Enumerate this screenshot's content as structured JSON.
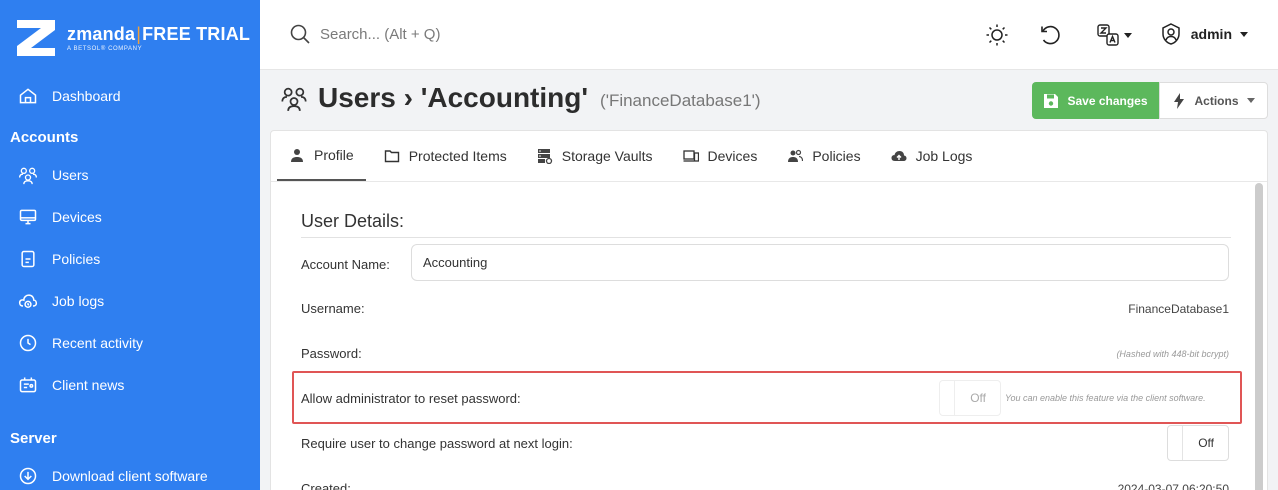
{
  "brand": {
    "name": "zmanda",
    "trial": "FREE TRIAL",
    "separator": "|",
    "tagline": "A BETSOL® COMPANY"
  },
  "sidebar": {
    "dashboard": "Dashboard",
    "accounts_heading": "Accounts",
    "accounts_items": [
      "Users",
      "Devices",
      "Policies",
      "Job logs",
      "Recent activity",
      "Client news"
    ],
    "server_heading": "Server",
    "server_items": [
      "Download client software"
    ]
  },
  "topbar": {
    "search_placeholder": "Search... (Alt + Q)",
    "user": "admin"
  },
  "page": {
    "title": "Users › 'Accounting'",
    "subtitle": "('FinanceDatabase1')"
  },
  "buttons": {
    "save": "Save changes",
    "actions": "Actions"
  },
  "tabs": [
    "Profile",
    "Protected Items",
    "Storage Vaults",
    "Devices",
    "Policies",
    "Job Logs"
  ],
  "details": {
    "section_title": "User Details:",
    "account_name_label": "Account Name:",
    "account_name_value": "Accounting",
    "username_label": "Username:",
    "username_value": "FinanceDatabase1",
    "password_label": "Password:",
    "password_hint": "(Hashed with 448-bit bcrypt)",
    "reset_label": "Allow administrator to reset password:",
    "reset_value": "Off",
    "reset_hint": "You can enable this feature via the client software.",
    "change_label": "Require user to change password at next login:",
    "change_value": "Off",
    "created_label": "Created:",
    "created_value": "2024-03-07 06:20:50"
  },
  "colors": {
    "sidebar": "#2f7ff0",
    "save": "#5cb85c",
    "highlight": "#e05555",
    "brand_separator": "#f2a03a"
  }
}
